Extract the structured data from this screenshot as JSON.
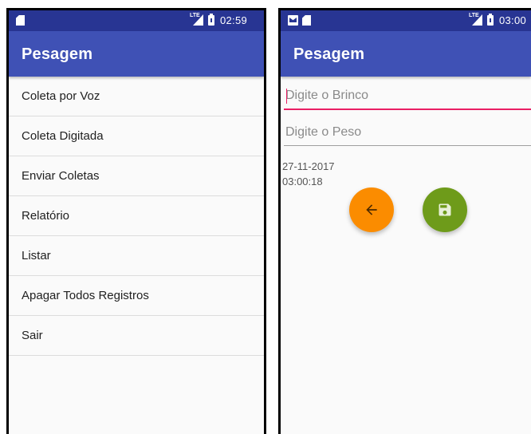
{
  "left_screen": {
    "status": {
      "network": "LTE",
      "time": "02:59"
    },
    "app_title": "Pesagem",
    "menu_items": [
      "Coleta por Voz",
      "Coleta Digitada",
      "Enviar Coletas",
      "Relatório",
      "Listar",
      "Apagar Todos Registros",
      "Sair"
    ]
  },
  "right_screen": {
    "status": {
      "network": "LTE",
      "time": "03:00"
    },
    "app_title": "Pesagem",
    "brinco_field": {
      "value": "",
      "placeholder": "Digite o Brinco"
    },
    "peso_field": {
      "value": "",
      "placeholder": "Digite o Peso"
    },
    "date": "27-11-2017",
    "time": "03:00:18",
    "icons": {
      "back_button": "arrow-left-icon",
      "save_button": "floppy-disk-icon"
    },
    "colors": {
      "back_fab": "#fb8c00",
      "save_fab": "#6e9b1a",
      "focus_line": "#e91e63"
    }
  },
  "theme": {
    "primary": "#3f51b5",
    "primary_dark": "#283593"
  }
}
